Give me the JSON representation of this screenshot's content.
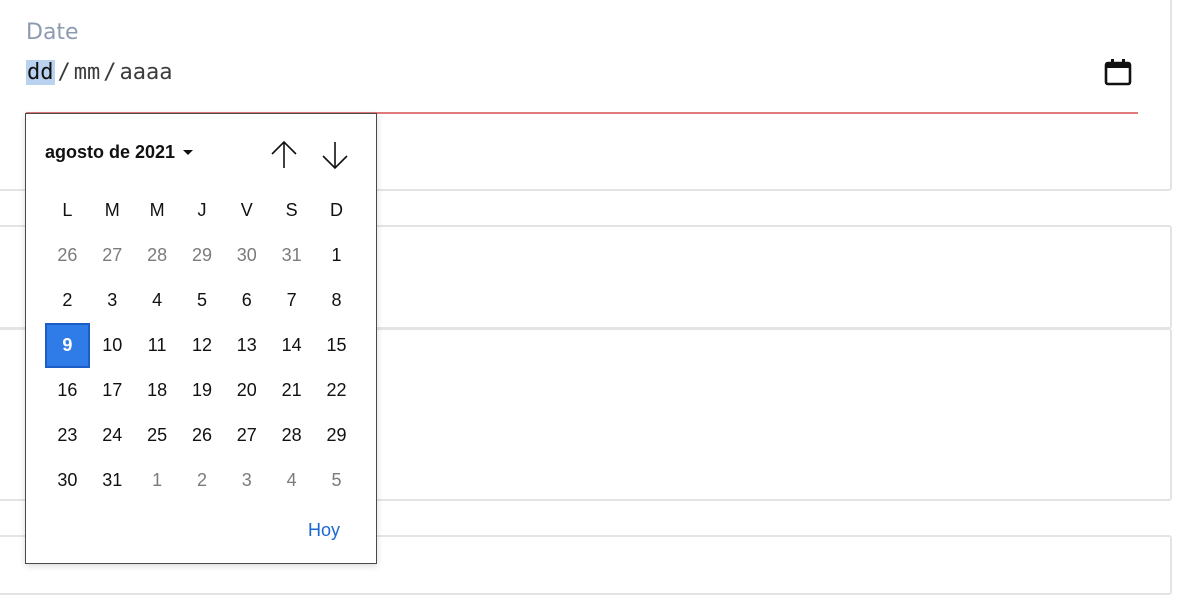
{
  "field": {
    "label": "Date",
    "segments": {
      "day": "dd",
      "sep1": "/",
      "month": "mm",
      "sep2": "/",
      "year": "aaaa"
    },
    "icon": "calendar-icon",
    "underline_color": "#e07a7a"
  },
  "picker": {
    "month_label": "agosto de 2021",
    "prev_icon": "arrow-up-icon",
    "next_icon": "arrow-down-icon",
    "weekdays": [
      "L",
      "M",
      "M",
      "J",
      "V",
      "S",
      "D"
    ],
    "weeks": [
      [
        {
          "d": "26",
          "o": 1
        },
        {
          "d": "27",
          "o": 1
        },
        {
          "d": "28",
          "o": 1
        },
        {
          "d": "29",
          "o": 1
        },
        {
          "d": "30",
          "o": 1
        },
        {
          "d": "31",
          "o": 1
        },
        {
          "d": "1",
          "o": 0
        }
      ],
      [
        {
          "d": "2",
          "o": 0
        },
        {
          "d": "3",
          "o": 0
        },
        {
          "d": "4",
          "o": 0
        },
        {
          "d": "5",
          "o": 0
        },
        {
          "d": "6",
          "o": 0
        },
        {
          "d": "7",
          "o": 0
        },
        {
          "d": "8",
          "o": 0
        }
      ],
      [
        {
          "d": "9",
          "o": 0,
          "sel": 1
        },
        {
          "d": "10",
          "o": 0
        },
        {
          "d": "11",
          "o": 0
        },
        {
          "d": "12",
          "o": 0
        },
        {
          "d": "13",
          "o": 0
        },
        {
          "d": "14",
          "o": 0
        },
        {
          "d": "15",
          "o": 0
        }
      ],
      [
        {
          "d": "16",
          "o": 0
        },
        {
          "d": "17",
          "o": 0
        },
        {
          "d": "18",
          "o": 0
        },
        {
          "d": "19",
          "o": 0
        },
        {
          "d": "20",
          "o": 0
        },
        {
          "d": "21",
          "o": 0
        },
        {
          "d": "22",
          "o": 0
        }
      ],
      [
        {
          "d": "23",
          "o": 0
        },
        {
          "d": "24",
          "o": 0
        },
        {
          "d": "25",
          "o": 0
        },
        {
          "d": "26",
          "o": 0
        },
        {
          "d": "27",
          "o": 0
        },
        {
          "d": "28",
          "o": 0
        },
        {
          "d": "29",
          "o": 0
        }
      ],
      [
        {
          "d": "30",
          "o": 0
        },
        {
          "d": "31",
          "o": 0
        },
        {
          "d": "1",
          "o": 1
        },
        {
          "d": "2",
          "o": 1
        },
        {
          "d": "3",
          "o": 1
        },
        {
          "d": "4",
          "o": 1
        },
        {
          "d": "5",
          "o": 1
        }
      ]
    ],
    "today_label": "Hoy",
    "accent_color": "#2f7ce8"
  }
}
